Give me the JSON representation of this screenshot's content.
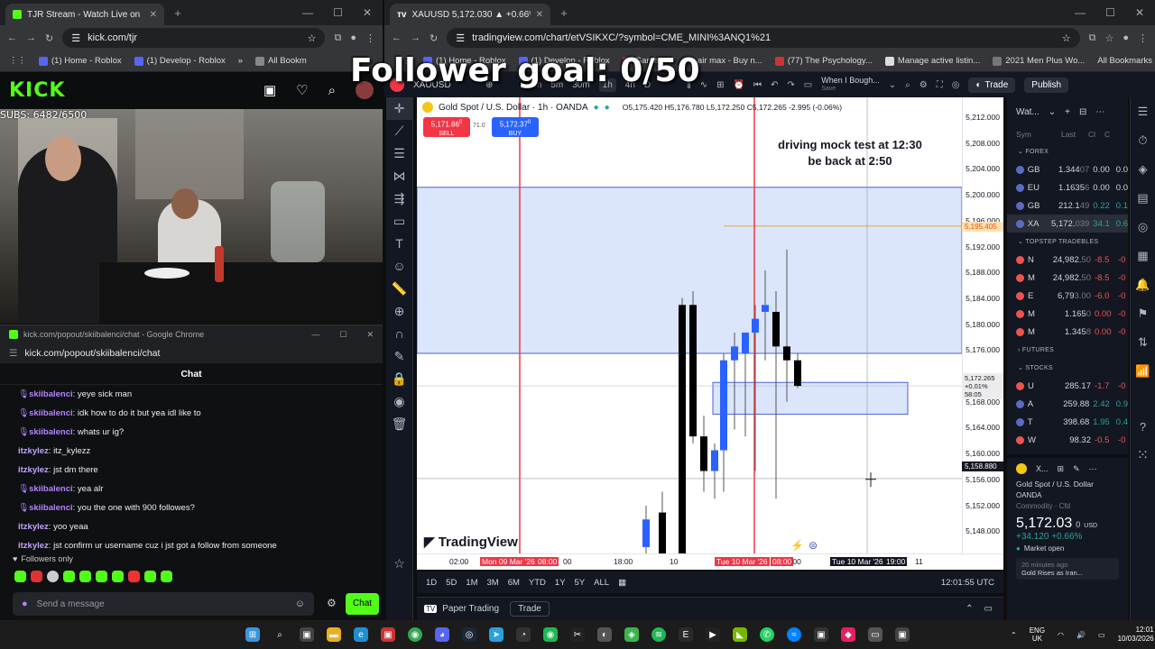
{
  "overlay": {
    "follower_goal": "Follower goal: 0/50"
  },
  "left_browser": {
    "tab_title": "TJR Stream - Watch Live on",
    "url": "kick.com/tjr",
    "bookmarks": [
      "(1) Home - Roblox",
      "(1) Develop - Roblox"
    ],
    "all_bookmarks": "All Bookm",
    "subs": "SUBS: 6482/6500",
    "logo": "KICK"
  },
  "chat_window": {
    "title": "kick.com/popout/skiibalenci/chat - Google Chrome",
    "url": "kick.com/popout/skiibalenci/chat",
    "header": "Chat",
    "messages": [
      {
        "user": "skiibalenci",
        "text": ": yeye sick man"
      },
      {
        "user": "skiibalenci",
        "text": ": idk how to do it but yea idl like to"
      },
      {
        "user": "skiibalenci",
        "text": ": whats ur ig?"
      },
      {
        "user": "itzkylez",
        "text": ": itz_kylezz"
      },
      {
        "user": "itzkylez",
        "text": ": jst dm there"
      },
      {
        "user": "skiibalenci",
        "text": ": yea alr"
      },
      {
        "user": "skiibalenci",
        "text": ": you the one with 900 followes?"
      },
      {
        "user": "itzkylez",
        "text": ": yoo yeaa"
      },
      {
        "user": "itzkylez",
        "text": ": jst confirm ur username cuz i jst got a follow from someone"
      }
    ],
    "followers_only": "Followers only",
    "placeholder": "Send a message",
    "chat_button": "Chat"
  },
  "tv_browser": {
    "tab_title": "XAUUSD 5,172.030 ▲ +0.66% W",
    "url": "tradingview.com/chart/etVSIKXC/?symbol=CME_MINI%3ANQ1%21",
    "bookmarks": [
      "(1) Home - Roblox",
      "(1) Develop - Roblox",
      "Gamer sc",
      "air max - Buy n...",
      "(77) The Psychology...",
      "Manage active listin...",
      "2021 Men Plus Wo..."
    ],
    "all_bookmarks": "All Bookmarks"
  },
  "tv_toolbar": {
    "symbol": "XAUUSD",
    "alert_label": "When I Bough...",
    "save": "Save",
    "trade": "Trade",
    "publish": "Publish",
    "intervals": [
      "3m",
      "5m",
      "30m",
      "1h",
      "4h",
      "D"
    ]
  },
  "chart": {
    "instrument": "Gold Spot / U.S. Dollar · 1h · OANDA",
    "ohlc": "O5,175.420 H5,176.780 L5,172.250 C5,172.265 -2.995 (-0.06%)",
    "sell_price": "5,171.66",
    "sell_sup": "0",
    "sell_label": "SELL",
    "spread": "71.0",
    "buy_price": "5,172.37",
    "buy_sup": "0",
    "buy_label": "BUY",
    "note_line1": "driving mock test at 12:30",
    "note_line2": "be back at 2:50",
    "watermark": "TradingView",
    "price_axis": [
      "5,212.000",
      "5,208.000",
      "5,204.000",
      "5,200.000",
      "5,196.000",
      "5,192.000",
      "5,188.000",
      "5,184.000",
      "5,180.000",
      "5,176.000",
      "5,172.000",
      "5,168.000",
      "5,164.000",
      "5,160.000",
      "5,156.000",
      "5,152.000",
      "5,148.000"
    ],
    "orange_level": "5,195.405",
    "last_price_tag": {
      "sym": "XAUUSD",
      "price": "5,172.265",
      "chg": "+0.01%",
      "timer": "58:05"
    },
    "crosshair_price": "5,158.880",
    "time_axis": [
      "02:00",
      "Mon 09 Mar '26",
      "08:00",
      "00",
      "18:00",
      "10",
      "Tue 10 Mar '26",
      "08:00",
      ":00",
      "Tue 10 Mar '26",
      "19:00",
      "11"
    ],
    "ranges": [
      "1D",
      "5D",
      "1M",
      "3M",
      "6M",
      "YTD",
      "1Y",
      "5Y",
      "ALL"
    ],
    "clock": "12:01:55 UTC",
    "paper_trading": "Paper Trading",
    "trade_tab": "Trade"
  },
  "watchlist": {
    "title": "Wat...",
    "cols": [
      "Sym",
      "Last",
      "Cl",
      "C"
    ],
    "sections": {
      "forex": "FOREX",
      "topstep": "TOPSTEP TRADEBLES",
      "futures": "FUTURES",
      "stocks": "STOCKS"
    },
    "forex": [
      {
        "sym": "GB",
        "last": "1.344",
        "dim": "07",
        "chg": "0.00",
        "pct": "0.0",
        "color": "#d1d4dc"
      },
      {
        "sym": "EU",
        "last": "1.1635",
        "dim": "6",
        "chg": "0.00",
        "pct": "0.0",
        "color": "#d1d4dc"
      },
      {
        "sym": "GB",
        "last": "212.1",
        "dim": "49",
        "chg": "0.22",
        "pct": "0.1",
        "color": "#26a69a"
      },
      {
        "sym": "XA",
        "last": "5,172.",
        "dim": "039",
        "chg": "34.1",
        "pct": "0.6",
        "color": "#26a69a"
      }
    ],
    "topstep": [
      {
        "sym": "N",
        "last": "24,982.",
        "dim": "50",
        "chg": "-8.5",
        "pct": "-0",
        "color": "#ef5350"
      },
      {
        "sym": "M",
        "last": "24,982.",
        "dim": "50",
        "chg": "-8.5",
        "pct": "-0",
        "color": "#ef5350"
      },
      {
        "sym": "E",
        "last": "6,79",
        "dim": "3.00",
        "chg": "-6.0",
        "pct": "-0",
        "color": "#ef5350"
      },
      {
        "sym": "M",
        "last": "1.165",
        "dim": "0",
        "chg": "0.00",
        "pct": "-0",
        "color": "#ef5350"
      },
      {
        "sym": "M",
        "last": "1.345",
        "dim": "8",
        "chg": "0.00",
        "pct": "-0",
        "color": "#ef5350"
      }
    ],
    "stocks": [
      {
        "sym": "U",
        "last": "285.17",
        "dim": "",
        "chg": "-1.7",
        "pct": "-0",
        "color": "#ef5350"
      },
      {
        "sym": "A",
        "last": "259.88",
        "dim": "",
        "chg": "2.42",
        "pct": "0.9",
        "color": "#26a69a"
      },
      {
        "sym": "T",
        "last": "398.68",
        "dim": "",
        "chg": "1.95",
        "pct": "0.4",
        "color": "#26a69a"
      },
      {
        "sym": "W",
        "last": "98.32",
        "dim": "",
        "chg": "-0.5",
        "pct": "-0",
        "color": "#ef5350"
      }
    ],
    "detail": {
      "sym": "X...",
      "name": "Gold Spot / U.S. Dollar",
      "src": "OANDA",
      "type": "Commodity · Cfd",
      "price": "5,172.03",
      "price_sup": "0",
      "ccy": "USD",
      "chg": "+34.120  +0.66%",
      "status": "Market open",
      "news_time": "20 minutes ago",
      "news": "Gold Rises as Iran..."
    }
  },
  "taskbar": {
    "lang1": "ENG",
    "lang2": "UK",
    "time": "12:01",
    "date": "10/03/2026"
  }
}
